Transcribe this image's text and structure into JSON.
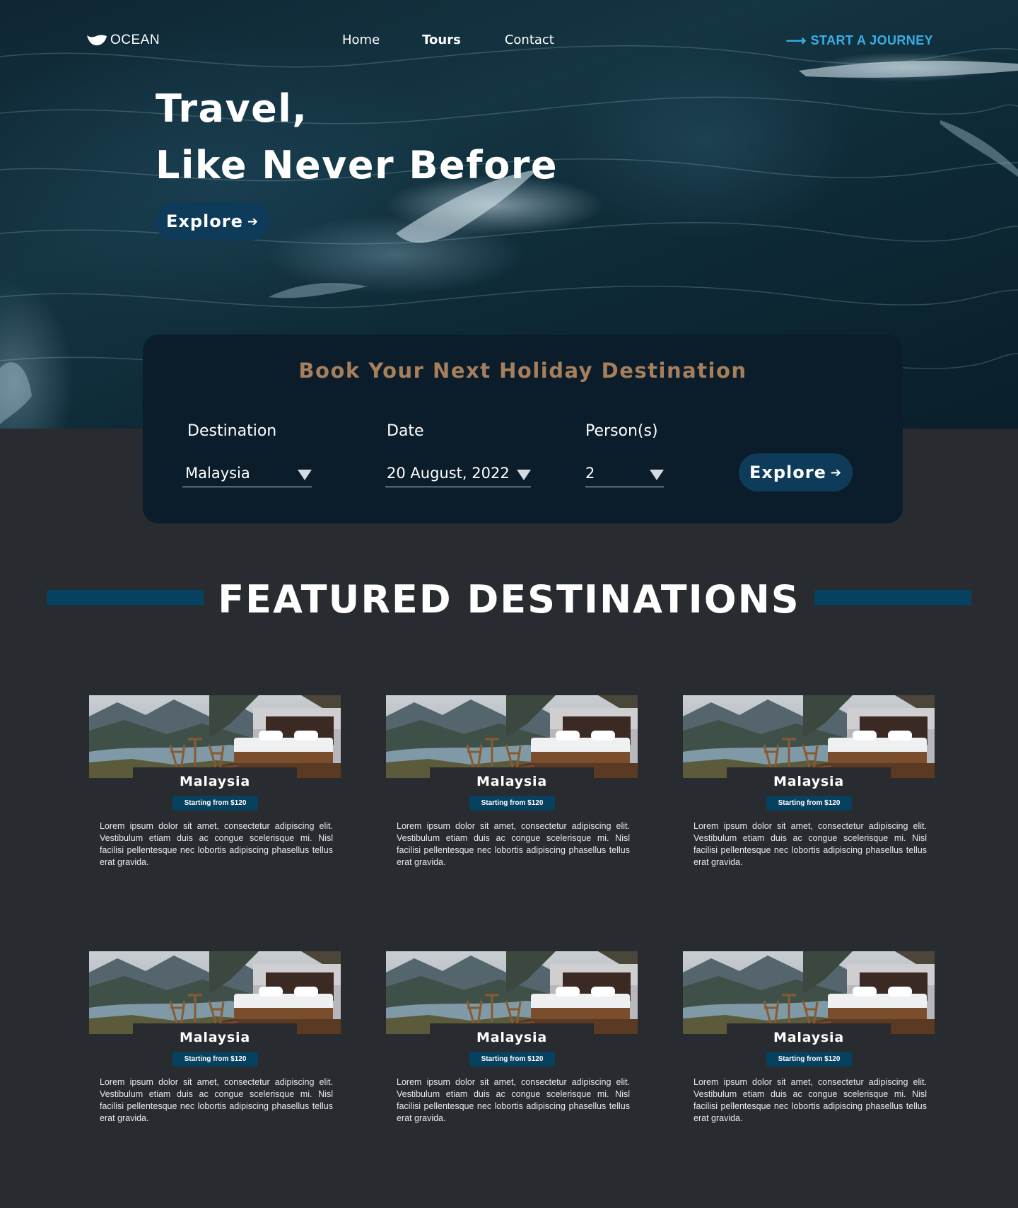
{
  "nav": {
    "logo_text": "OCEAN",
    "links": [
      "Home",
      "Tours",
      "Contact"
    ],
    "cta_label": "START A JOURNEY",
    "cta_arrow": "⟶"
  },
  "hero": {
    "title_line1": "Travel,",
    "title_line2": "Like Never Before",
    "button_label": "Explore",
    "button_arrow": "➔"
  },
  "booking": {
    "title": "Book Your Next Holiday Destination",
    "fields": [
      {
        "label": "Destination",
        "value": "Malaysia"
      },
      {
        "label": "Date",
        "value": "20 August, 2022"
      },
      {
        "label": "Person(s)",
        "value": "2"
      }
    ],
    "button_label": "Explore",
    "button_arrow": "➔"
  },
  "featured": {
    "title": "FEATURED DESTINATIONS",
    "cards": [
      {
        "name": "Malaysia",
        "price": "Starting from $120",
        "description": "Lorem ipsum dolor sit amet, consectetur adipiscing elit. Vestibulum etiam duis ac congue scelerisque mi. Nisl facilisi pellentesque nec lobortis adipiscing phasellus tellus erat gravida."
      },
      {
        "name": "Malaysia",
        "price": "Starting from $120",
        "description": "Lorem ipsum dolor sit amet, consectetur adipiscing elit. Vestibulum etiam duis ac congue scelerisque mi. Nisl facilisi pellentesque nec lobortis adipiscing phasellus tellus erat gravida."
      },
      {
        "name": "Malaysia",
        "price": "Starting from $120",
        "description": "Lorem ipsum dolor sit amet, consectetur adipiscing elit. Vestibulum etiam duis ac congue scelerisque mi. Nisl facilisi pellentesque nec lobortis adipiscing phasellus tellus erat gravida."
      },
      {
        "name": "Malaysia",
        "price": "Starting from $120",
        "description": "Lorem ipsum dolor sit amet, consectetur adipiscing elit. Vestibulum etiam duis ac congue scelerisque mi. Nisl facilisi pellentesque nec lobortis adipiscing phasellus tellus erat gravida."
      },
      {
        "name": "Malaysia",
        "price": "Starting from $120",
        "description": "Lorem ipsum dolor sit amet, consectetur adipiscing elit. Vestibulum etiam duis ac congue scelerisque mi. Nisl facilisi pellentesque nec lobortis adipiscing phasellus tellus erat gravida."
      },
      {
        "name": "Malaysia",
        "price": "Starting from $120",
        "description": "Lorem ipsum dolor sit amet, consectetur adipiscing elit. Vestibulum etiam duis ac congue scelerisque mi. Nisl facilisi pellentesque nec lobortis adipiscing phasellus tellus erat gravida."
      }
    ]
  },
  "icons": {
    "logo": "wave-logo-icon",
    "dropdown": "caret-down-icon",
    "arrow": "arrow-right-icon"
  },
  "colors": {
    "page_background": "#282b2f",
    "card_navy": "#0b1d2b",
    "button_blue": "#0d3b59",
    "accent_bar": "#06415f",
    "cta_blue": "#3aaee7",
    "booking_title": "#a77f5b"
  }
}
